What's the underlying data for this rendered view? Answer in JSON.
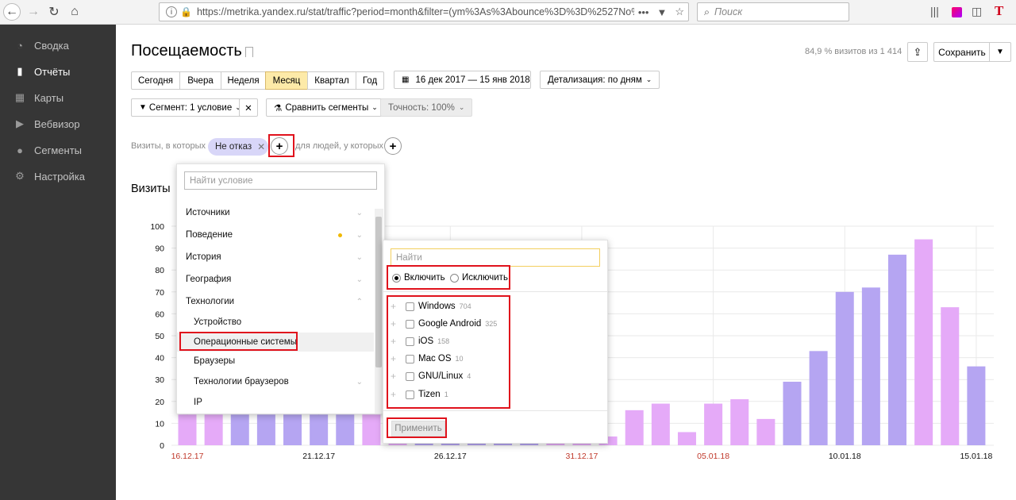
{
  "browser": {
    "url": "https://metrika.yandex.ru/stat/traffic?period=month&filter=(ym%3As%3Abounce%3D%3D%2527No%252",
    "search_placeholder": "Поиск",
    "title_ext": "T"
  },
  "sidebar": {
    "items": [
      {
        "label": "Сводка",
        "icon": "gauge-icon"
      },
      {
        "label": "Отчёты",
        "icon": "bar-chart-icon"
      },
      {
        "label": "Карты",
        "icon": "map-icon"
      },
      {
        "label": "Вебвизор",
        "icon": "play-icon"
      },
      {
        "label": "Сегменты",
        "icon": "segments-icon"
      },
      {
        "label": "Настройка",
        "icon": "gear-icon"
      }
    ]
  },
  "header": {
    "title": "Посещаемость",
    "visits_share": "84,9 % визитов из 1 414",
    "save_label": "Сохранить"
  },
  "periods": [
    "Сегодня",
    "Вчера",
    "Неделя",
    "Месяц",
    "Квартал",
    "Год"
  ],
  "active_period": "Месяц",
  "date_range": "16 дек 2017 — 15 янв 2018",
  "detail": "Детализация: по дням",
  "segment": "Сегмент: 1 условие",
  "compare": "Сравнить сегменты",
  "accuracy": "Точность: 100%",
  "filter_row": {
    "label": "Визиты, в которых",
    "chip": "Не отказ",
    "people_label": "для людей, у которых"
  },
  "visits_heading": "Визиты",
  "condition_menu": {
    "placeholder": "Найти условие",
    "items": [
      "Источники",
      "Поведение",
      "История",
      "География",
      "Технологии"
    ],
    "subitems": [
      "Устройство",
      "Операционные системы",
      "Браузеры",
      "Технологии браузеров",
      "IP"
    ]
  },
  "os_menu": {
    "placeholder": "Найти",
    "include": "Включить",
    "exclude": "Исключить",
    "options": [
      {
        "name": "Windows",
        "count": "704"
      },
      {
        "name": "Google Android",
        "count": "325"
      },
      {
        "name": "iOS",
        "count": "158"
      },
      {
        "name": "Mac OS",
        "count": "10"
      },
      {
        "name": "GNU/Linux",
        "count": "4"
      },
      {
        "name": "Tizen",
        "count": "1"
      }
    ],
    "apply": "Применить"
  },
  "colors": {
    "weekday": "#b5a5f2",
    "weekend": "#e5aaf8",
    "weekend_label": "#c0392b",
    "sidebar": "#363636"
  },
  "chart_data": {
    "type": "bar",
    "ylim": [
      0,
      100
    ],
    "yticks": [
      "0",
      "10",
      "20",
      "30",
      "40",
      "50",
      "60",
      "70",
      "80",
      "90",
      "100"
    ],
    "xtick_labels": [
      {
        "label": "16.12.17",
        "weekend": true
      },
      {
        "label": "21.12.17",
        "weekend": false
      },
      {
        "label": "26.12.17",
        "weekend": false
      },
      {
        "label": "31.12.17",
        "weekend": true
      },
      {
        "label": "05.01.18",
        "weekend": true
      },
      {
        "label": "10.01.18",
        "weekend": false
      },
      {
        "label": "15.01.18",
        "weekend": false
      }
    ],
    "categories": [
      "16.12",
      "17.12",
      "18.12",
      "19.12",
      "20.12",
      "21.12",
      "22.12",
      "23.12",
      "24.12",
      "25.12",
      "26.12",
      "27.12",
      "28.12",
      "29.12",
      "30.12",
      "31.12",
      "01.01",
      "02.01",
      "03.01",
      "04.01",
      "05.01",
      "06.01",
      "07.01",
      "08.01",
      "09.01",
      "10.01",
      "11.01",
      "12.01",
      "13.01",
      "14.01",
      "15.01"
    ],
    "weekend": [
      true,
      true,
      false,
      false,
      false,
      false,
      false,
      true,
      true,
      false,
      false,
      false,
      false,
      false,
      true,
      true,
      true,
      true,
      true,
      true,
      true,
      true,
      true,
      false,
      false,
      false,
      false,
      false,
      true,
      true,
      false
    ],
    "values": [
      14,
      14,
      14,
      14,
      14,
      14,
      14,
      14,
      2,
      2,
      2,
      2,
      2,
      2,
      2,
      2,
      4,
      16,
      19,
      6,
      19,
      21,
      12,
      29,
      43,
      70,
      72,
      87,
      94,
      63,
      36
    ]
  }
}
